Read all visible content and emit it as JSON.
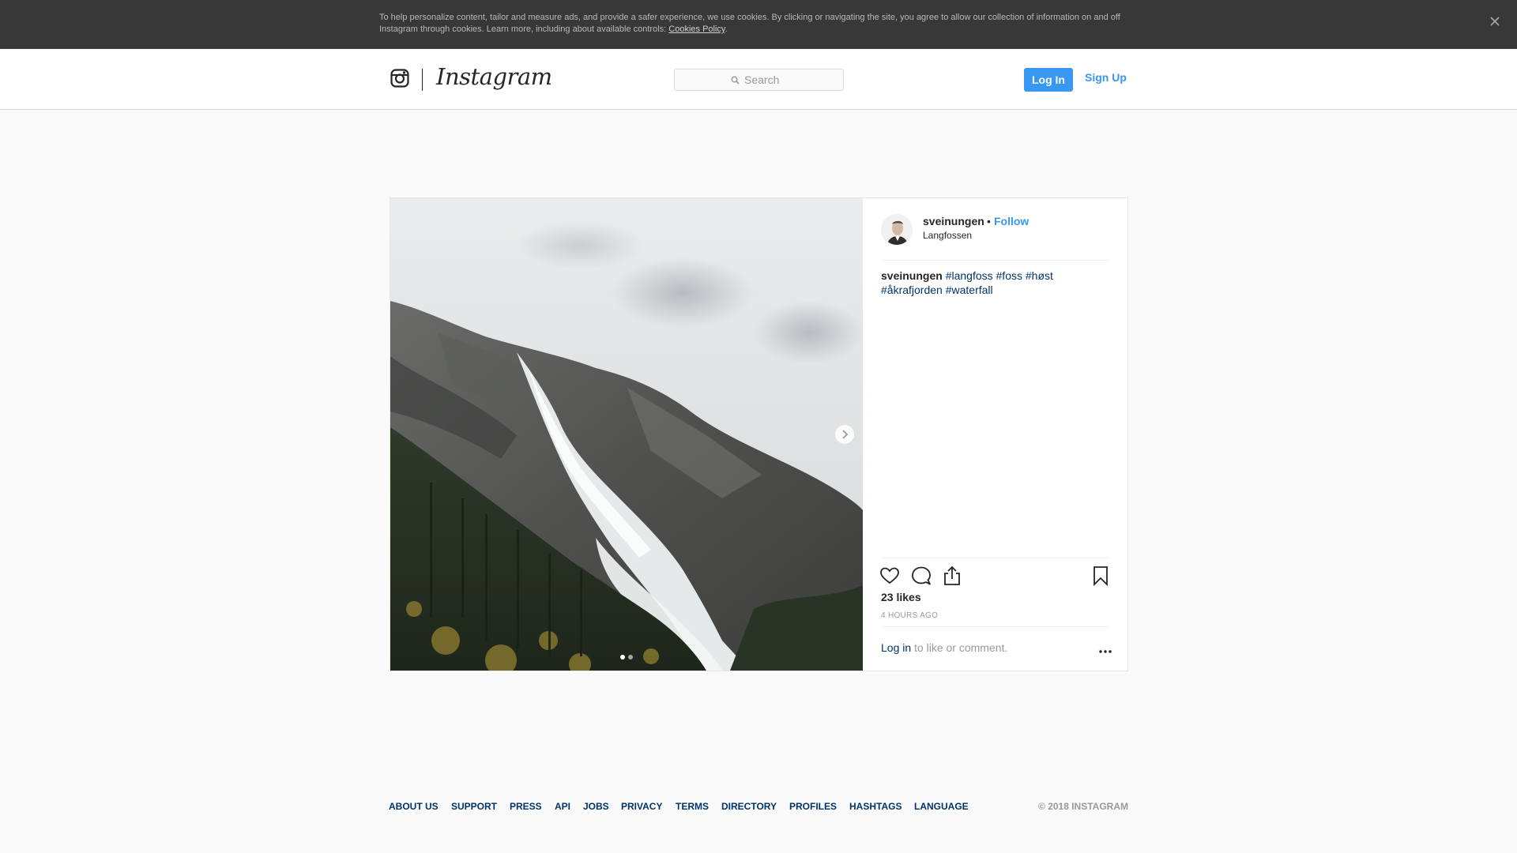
{
  "cookie_banner": {
    "text": "To help personalize content, tailor and measure ads, and provide a safer experience, we use cookies. By clicking or navigating the site, you agree to allow our collection of information on and off Instagram through cookies. Learn more, including about available controls: ",
    "link_label": "Cookies Policy",
    "suffix": ".",
    "close_icon": "close-icon"
  },
  "nav": {
    "brand": "Instagram",
    "logo_icon": "camera-icon",
    "search_placeholder": "Search",
    "login_label": "Log In",
    "signup_label": "Sign Up"
  },
  "post": {
    "username": "sveinungen",
    "separator": "•",
    "follow_label": "Follow",
    "location": "Langfossen",
    "caption_user": "sveinungen",
    "hashtags": [
      "#langfoss",
      "#foss",
      "#høst",
      "#åkrafjorden",
      "#waterfall"
    ],
    "likes": "23 likes",
    "time": "4 HOURS AGO",
    "login_prompt_link": "Log in",
    "login_prompt_text": " to like or comment.",
    "carousel": {
      "total": 2,
      "active": 1
    },
    "icons": [
      "heart-icon",
      "comment-icon",
      "share-icon",
      "bookmark-icon",
      "more-icon",
      "chevron-right-icon"
    ]
  },
  "footer": {
    "links": [
      "ABOUT US",
      "SUPPORT",
      "PRESS",
      "API",
      "JOBS",
      "PRIVACY",
      "TERMS",
      "DIRECTORY",
      "PROFILES",
      "HASHTAGS",
      "LANGUAGE"
    ],
    "copyright": "© 2018 INSTAGRAM"
  },
  "colors": {
    "accent": "#3897f0",
    "link": "#003569",
    "banner": "#383838",
    "muted": "#999999"
  }
}
